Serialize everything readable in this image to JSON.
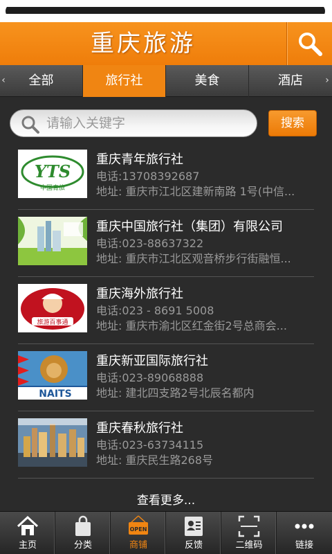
{
  "header": {
    "title": "重庆旅游"
  },
  "tabs": {
    "left_arrow": "‹",
    "right_arrow": "›",
    "items": [
      "全部",
      "旅行社",
      "美食",
      "酒店"
    ],
    "active_index": 1
  },
  "search": {
    "placeholder": "请输入关键字",
    "value": "",
    "button_label": "搜索"
  },
  "list": [
    {
      "name": "重庆青年旅行社",
      "phone": "电话:13708392687",
      "address": "地址: 重庆市江北区建新南路 1号(中信...",
      "logo_text": "YTS",
      "logo_sub": "中国青旅"
    },
    {
      "name": "重庆中国旅行社（集团）有限公司",
      "phone": "电话:023-88637322",
      "address": "地址: 重庆市江北区观音桥步行街融恒..."
    },
    {
      "name": "重庆海外旅行社",
      "phone": "电话:023 - 8691 5008",
      "address": "地址: 重庆市渝北区红金街2号总商会...",
      "logo_sub": "旅游百事通"
    },
    {
      "name": "重庆新亚国际旅行社",
      "phone": "电话:023-89068888",
      "address": "地址: 建北四支路2号北辰名都内",
      "logo_text": "NAITS"
    },
    {
      "name": "重庆春秋旅行社",
      "phone": "电话:023-63734115",
      "address": "地址: 重庆民生路268号"
    }
  ],
  "view_more": "查看更多...",
  "bottom_nav": {
    "items": [
      "主页",
      "分类",
      "商铺",
      "反馈",
      "二维码",
      "链接"
    ],
    "active_index": 2,
    "open_badge": "OPEN"
  },
  "colors": {
    "accent": "#f08512",
    "background": "#2b2b2b",
    "secondary_text": "#9a9a9a"
  }
}
